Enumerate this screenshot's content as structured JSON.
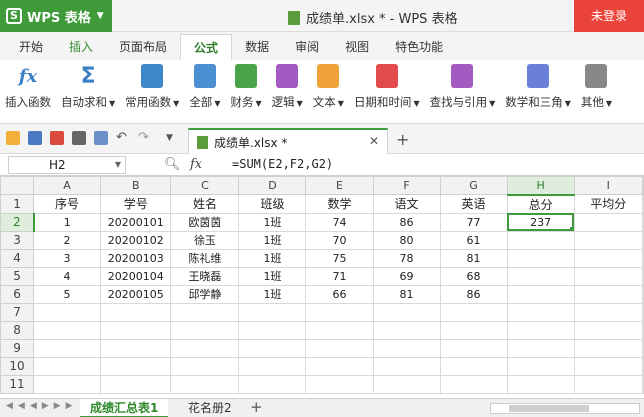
{
  "app": {
    "name": "WPS 表格",
    "logo": "S"
  },
  "window": {
    "title": "成绩单.xlsx * - WPS 表格",
    "login_label": "未登录"
  },
  "menu_tabs": [
    "开始",
    "插入",
    "页面布局",
    "公式",
    "数据",
    "审阅",
    "视图",
    "特色功能"
  ],
  "active_menu_tab": "公式",
  "ribbon": [
    {
      "label": "插入函数",
      "icon": "fx-icon",
      "color": "#3a7fc4"
    },
    {
      "label": "自动求和",
      "icon": "sigma-icon",
      "color": "#3a7fc4"
    },
    {
      "label": "常用函数",
      "icon": "star-book-icon",
      "color": "#3d86c9"
    },
    {
      "label": "全部",
      "icon": "list-book-icon",
      "color": "#4a90d0"
    },
    {
      "label": "财务",
      "icon": "finance-book-icon",
      "color": "#4aa24a"
    },
    {
      "label": "逻辑",
      "icon": "question-book-icon",
      "color": "#a35bc1"
    },
    {
      "label": "文本",
      "icon": "text-book-icon",
      "color": "#f0a23a"
    },
    {
      "label": "日期和时间",
      "icon": "clock-book-icon",
      "color": "#e24b4b"
    },
    {
      "label": "查找与引用",
      "icon": "search-book-icon",
      "color": "#a35bc1"
    },
    {
      "label": "数学和三角",
      "icon": "theta-book-icon",
      "color": "#6a7fd8"
    },
    {
      "label": "其他",
      "icon": "more-book-icon",
      "color": "#888888"
    }
  ],
  "document_tab": {
    "label": "成绩单.xlsx *"
  },
  "formula_bar": {
    "cell_ref": "H2",
    "fx": "fx",
    "formula": "=SUM(E2,F2,G2)"
  },
  "sheet": {
    "columns": [
      "A",
      "B",
      "C",
      "D",
      "E",
      "F",
      "G",
      "H",
      "I"
    ],
    "rows": [
      "1",
      "2",
      "3",
      "4",
      "5",
      "6",
      "7",
      "8",
      "9",
      "10",
      "11"
    ],
    "selected_column": "H",
    "selected_row": "2",
    "cells": [
      [
        "序号",
        "学号",
        "姓名",
        "班级",
        "数学",
        "语文",
        "英语",
        "总分",
        "平均分"
      ],
      [
        "1",
        "20200101",
        "欧茵茵",
        "1班",
        "74",
        "86",
        "77",
        "237",
        ""
      ],
      [
        "2",
        "20200102",
        "徐玉",
        "1班",
        "70",
        "80",
        "61",
        "",
        ""
      ],
      [
        "3",
        "20200103",
        "陈礼维",
        "1班",
        "75",
        "78",
        "81",
        "",
        ""
      ],
      [
        "4",
        "20200104",
        "王晓磊",
        "1班",
        "71",
        "69",
        "68",
        "",
        ""
      ],
      [
        "5",
        "20200105",
        "邱学静",
        "1班",
        "66",
        "81",
        "86",
        "",
        ""
      ],
      [
        "",
        "",
        "",
        "",
        "",
        "",
        "",
        "",
        ""
      ],
      [
        "",
        "",
        "",
        "",
        "",
        "",
        "",
        "",
        ""
      ],
      [
        "",
        "",
        "",
        "",
        "",
        "",
        "",
        "",
        ""
      ],
      [
        "",
        "",
        "",
        "",
        "",
        "",
        "",
        "",
        ""
      ],
      [
        "",
        "",
        "",
        "",
        "",
        "",
        "",
        "",
        ""
      ]
    ]
  },
  "sheet_tabs": [
    "成绩汇总表1",
    "花名册2"
  ],
  "active_sheet": "成绩汇总表1",
  "colors": {
    "brand": "#3f9b3a",
    "login": "#e9433a"
  }
}
